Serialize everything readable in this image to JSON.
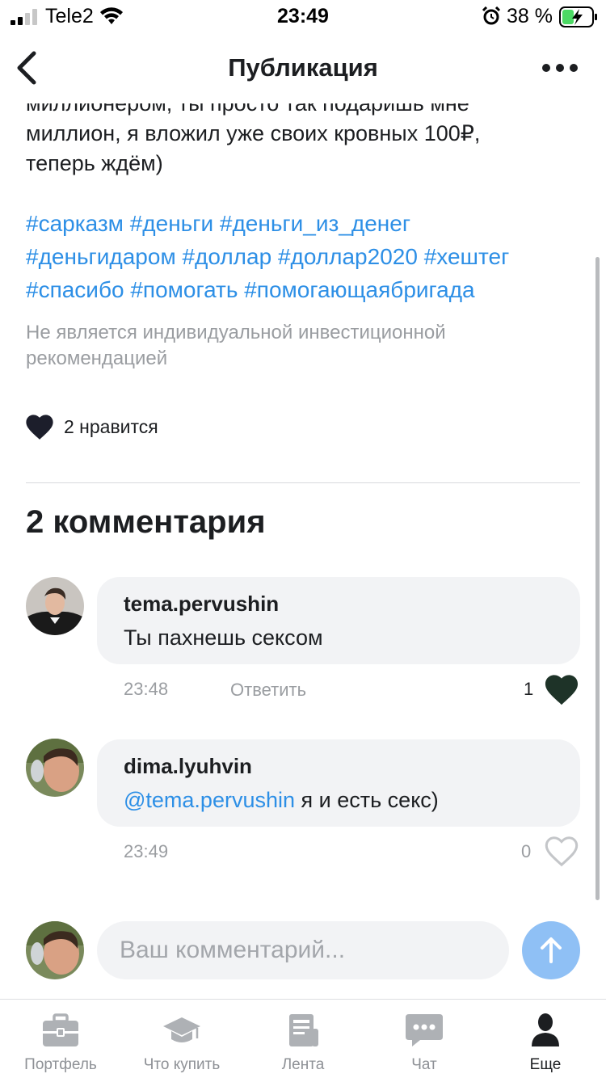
{
  "status_bar": {
    "carrier": "Tele2",
    "time": "23:49",
    "battery": "38 %"
  },
  "header": {
    "title": "Публикация"
  },
  "post": {
    "text_lines": [
      "миллионером, ты просто так подаришь мне",
      "миллион, я вложил уже своих кровных 100₽,",
      "теперь ждём)"
    ],
    "hashtag_lines": [
      "#сарказм #деньги #деньги_из_денег",
      "#деньгидаром #доллар #доллар2020 #хештег",
      "#спасибо #помогать #помогающаябригада"
    ],
    "disclaimer_lines": [
      "Не является индивидуальной инвестиционной",
      "рекомендацией"
    ],
    "likes": "2 нравится"
  },
  "comments_section": {
    "title": "2 комментария",
    "comments": [
      {
        "author": "tema.pervushin",
        "mention": "",
        "text": "Ты пахнешь сексом",
        "time": "23:48",
        "reply_label": "Ответить",
        "like_count": "1",
        "liked": true
      },
      {
        "author": "dima.lyuhvin",
        "mention": "@tema.pervushin",
        "text": " я и есть секс)",
        "time": "23:49",
        "like_count": "0",
        "liked": false
      }
    ]
  },
  "comment_input": {
    "placeholder": "Ваш комментарий..."
  },
  "tab_bar": {
    "tabs": [
      {
        "label": "Портфель",
        "icon": "briefcase-icon"
      },
      {
        "label": "Что купить",
        "icon": "graduation-cap-icon"
      },
      {
        "label": "Лента",
        "icon": "newspaper-icon"
      },
      {
        "label": "Чат",
        "icon": "chat-bubble-icon"
      },
      {
        "label": "Еще",
        "icon": "profile-icon"
      }
    ],
    "active": "Еще"
  },
  "colors": {
    "link": "#2d8fe6",
    "muted_text": "#9a9da1",
    "bubble_bg": "#f2f3f5",
    "send_button": "#8fc0f5",
    "liked_heart": "#1e3328"
  }
}
